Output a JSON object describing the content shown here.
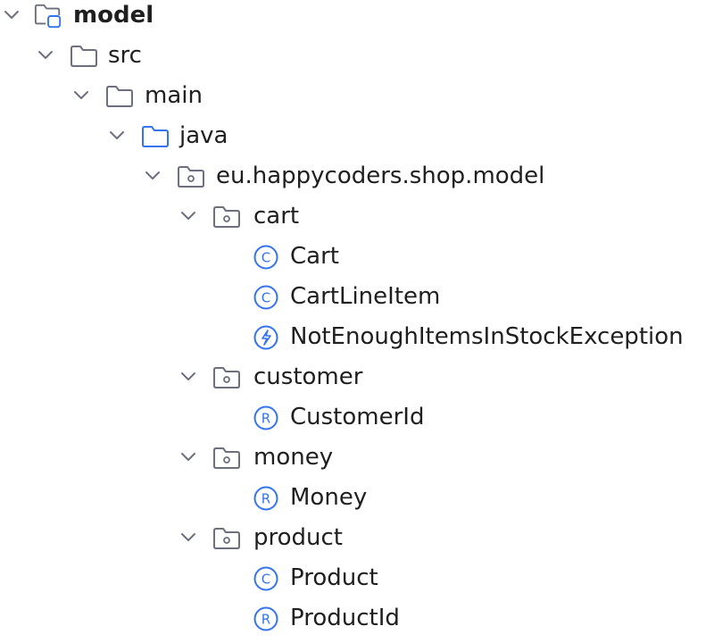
{
  "tree": [
    {
      "label": "model",
      "icon": "module-icon",
      "expanded": true,
      "bold": true
    },
    {
      "label": "src",
      "icon": "folder-icon",
      "expanded": true
    },
    {
      "label": "main",
      "icon": "folder-icon",
      "expanded": true
    },
    {
      "label": "java",
      "icon": "source-folder-icon",
      "expanded": true
    },
    {
      "label": "eu.happycoders.shop.model",
      "icon": "package-icon",
      "expanded": true
    },
    {
      "label": "cart",
      "icon": "package-icon",
      "expanded": true
    },
    {
      "label": "Cart",
      "icon": "class-icon",
      "glyph": "C"
    },
    {
      "label": "CartLineItem",
      "icon": "class-icon",
      "glyph": "C"
    },
    {
      "label": "NotEnoughItemsInStockException",
      "icon": "exception-class-icon"
    },
    {
      "label": "customer",
      "icon": "package-icon",
      "expanded": true
    },
    {
      "label": "CustomerId",
      "icon": "record-icon",
      "glyph": "R"
    },
    {
      "label": "money",
      "icon": "package-icon",
      "expanded": true
    },
    {
      "label": "Money",
      "icon": "record-icon",
      "glyph": "R"
    },
    {
      "label": "product",
      "icon": "package-icon",
      "expanded": true
    },
    {
      "label": "Product",
      "icon": "class-icon",
      "glyph": "C"
    },
    {
      "label": "ProductId",
      "icon": "record-icon",
      "glyph": "R"
    }
  ],
  "colors": {
    "text": "#1f1f1f",
    "chevron": "#6c707e",
    "folder_stroke": "#6c707e",
    "source_folder_stroke": "#3574f0",
    "class_icon": "#3574f0",
    "module_badge": "#3574f0"
  }
}
